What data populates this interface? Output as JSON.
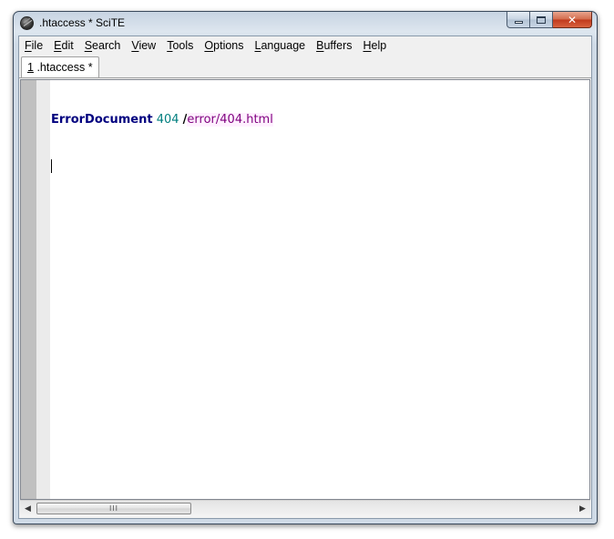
{
  "window": {
    "title": ".htaccess * SciTE",
    "close_glyph": "✕"
  },
  "menu": {
    "items": [
      {
        "label": "File",
        "accel": "F",
        "rest": "ile"
      },
      {
        "label": "Edit",
        "accel": "E",
        "rest": "dit"
      },
      {
        "label": "Search",
        "accel": "S",
        "rest": "earch"
      },
      {
        "label": "View",
        "accel": "V",
        "rest": "iew"
      },
      {
        "label": "Tools",
        "accel": "T",
        "rest": "ools"
      },
      {
        "label": "Options",
        "accel": "O",
        "rest": "ptions"
      },
      {
        "label": "Language",
        "accel": "L",
        "rest": "anguage"
      },
      {
        "label": "Buffers",
        "accel": "B",
        "rest": "uffers"
      },
      {
        "label": "Help",
        "accel": "H",
        "rest": "elp"
      }
    ]
  },
  "tabs": [
    {
      "number": "1",
      "name": ".htaccess *"
    }
  ],
  "editor": {
    "line1": {
      "directive": "ErrorDocument",
      "code": "404",
      "slash": "/",
      "path": "error/404.html"
    }
  },
  "scrollbar": {
    "left_arrow": "◀",
    "right_arrow": "▶",
    "grip": "III"
  }
}
